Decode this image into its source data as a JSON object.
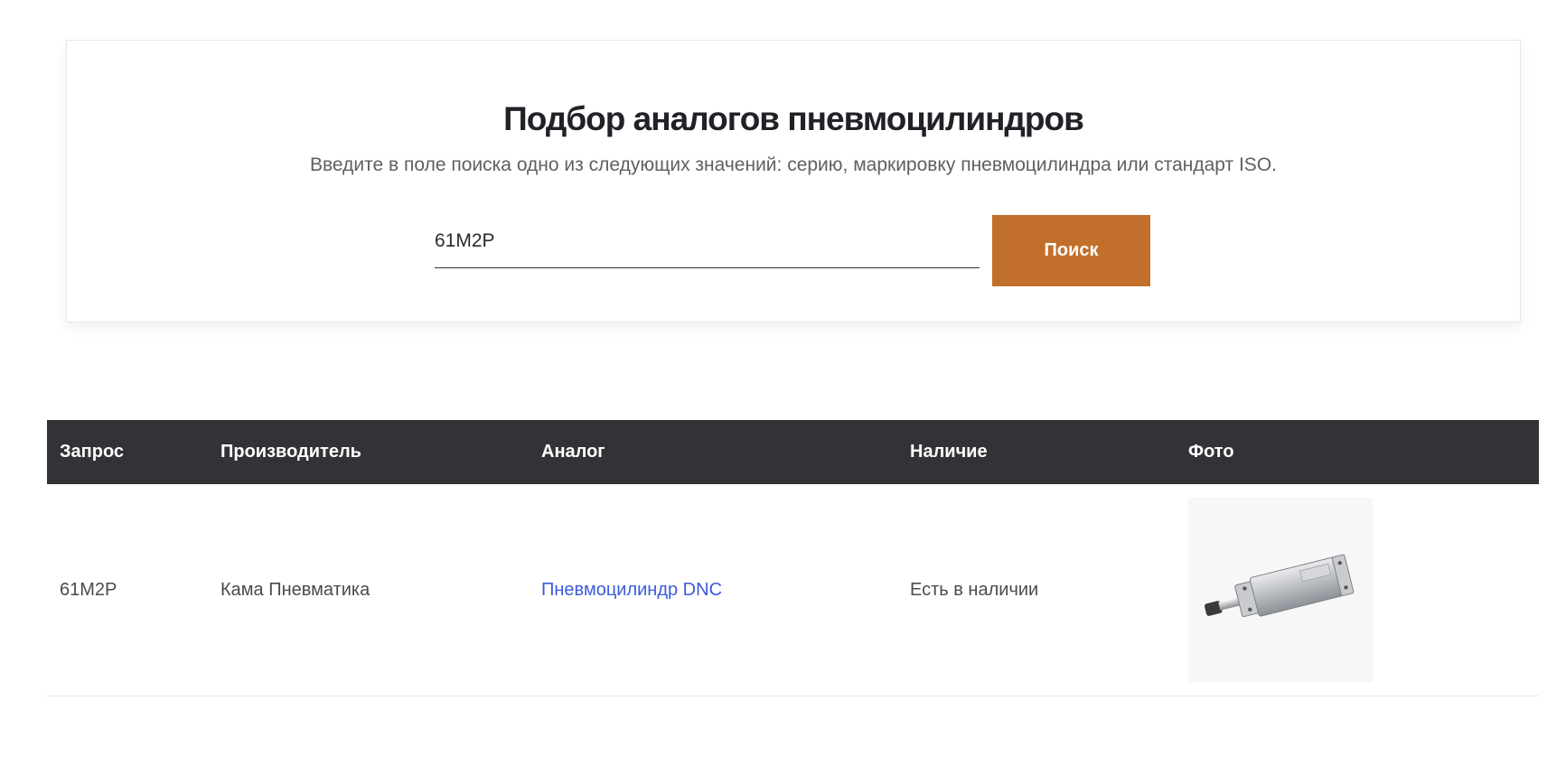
{
  "search": {
    "title": "Подбор аналогов пневмоцилиндров",
    "subtitle": "Введите в поле поиска одно из следующих значений: серию, маркировку пневмоцилиндра или стандарт ISO.",
    "input_value": "61M2P",
    "button_label": "Поиск"
  },
  "table": {
    "headers": [
      "Запрос",
      "Производитель",
      "Аналог",
      "Наличие",
      "Фото"
    ],
    "rows": [
      {
        "query": "61M2P",
        "manufacturer": "Кама Пневматика",
        "analog": "Пневмоцилиндр DNC",
        "availability": "Есть в наличии",
        "photo": "pneumatic-cylinder-image"
      }
    ]
  },
  "colors": {
    "accent": "#c26f2b",
    "header_bg": "#333236",
    "link": "#3d5bdc"
  }
}
